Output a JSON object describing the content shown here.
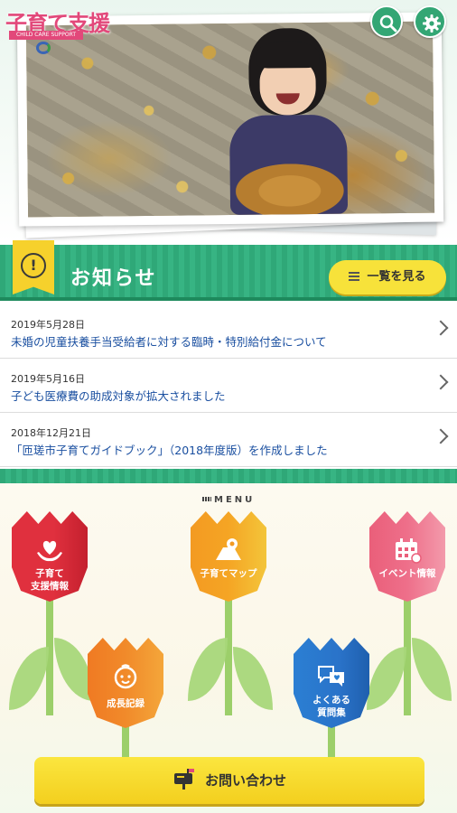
{
  "app": {
    "logo_text": "子育て支援",
    "logo_sub": "CHILD CARE SUPPORT"
  },
  "header": {
    "search_icon": "search-icon",
    "settings_icon": "gear-icon",
    "accent": "#33a674"
  },
  "news": {
    "title": "お知らせ",
    "badge": "!",
    "list_button": "一覧を見る",
    "items": [
      {
        "date": "2019年5月28日",
        "text": "未婚の児童扶養手当受給者に対する臨時・特別給付金について"
      },
      {
        "date": "2019年5月16日",
        "text": "子ども医療費の助成対象が拡大されました"
      },
      {
        "date": "2018年12月21日",
        "text": "「匝瑳市子育てガイドブック」（2018年度版）を作成しました"
      }
    ]
  },
  "menu": {
    "label": "MENU",
    "items": [
      {
        "label1": "子育て",
        "label2": "支援情報",
        "color": "#e0303e",
        "icon": "heart-hands-icon"
      },
      {
        "label1": "子育てマップ",
        "label2": "",
        "color": "#f39a22",
        "icon": "map-pin-icon"
      },
      {
        "label1": "イベント情報",
        "label2": "",
        "color": "#ea5f7a",
        "icon": "calendar-icon"
      },
      {
        "label1": "成長記録",
        "label2": "",
        "color": "#f07a23",
        "icon": "baby-face-icon"
      },
      {
        "label1": "よくある",
        "label2": "質問集",
        "color": "#2b7fd3",
        "icon": "chat-bubbles-icon"
      }
    ],
    "contact_label": "お問い合わせ",
    "contact_icon": "mailbox-icon"
  }
}
